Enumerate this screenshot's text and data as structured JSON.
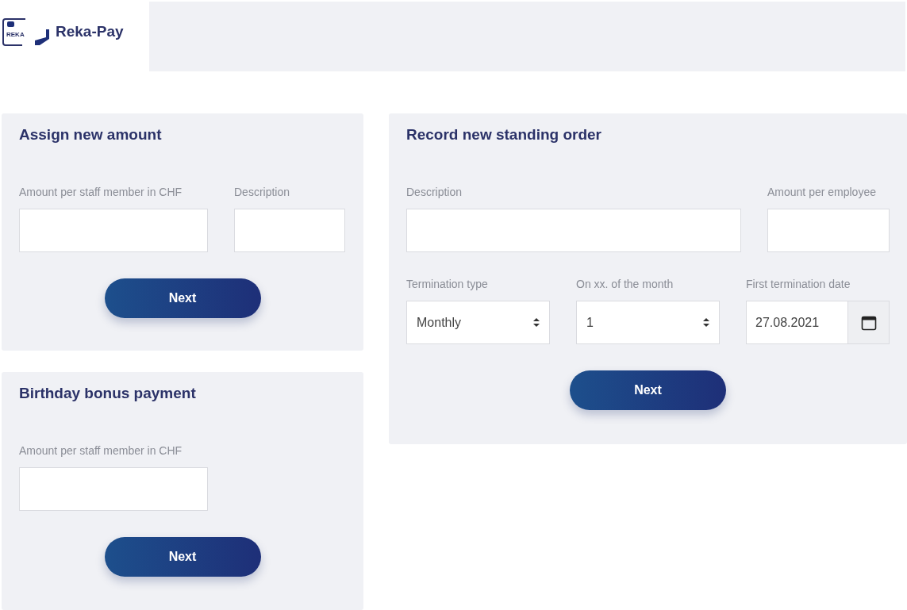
{
  "header": {
    "logo_card_text": "REKA",
    "brand": "Reka-Pay"
  },
  "assign_amount": {
    "title": "Assign new amount",
    "fields": [
      {
        "label": "Amount per staff member in CHF"
      },
      {
        "label": "Description"
      }
    ],
    "button": "Next"
  },
  "birthday_bonus": {
    "title": "Birthday bonus payment",
    "fields": [
      {
        "label": "Amount per staff member in CHF"
      }
    ],
    "button": "Next"
  },
  "standing_order": {
    "title": "Record new standing order",
    "fields": [
      {
        "label": "Description"
      },
      {
        "label": "Amount per employee"
      }
    ],
    "termination_type": {
      "label": "Termination type",
      "value": "Monthly"
    },
    "day_of_month": {
      "label": "On xx. of the month",
      "value": "1"
    },
    "first_termination_date": {
      "label": "First termination date",
      "value": "27.08.2021"
    },
    "button": "Next"
  }
}
